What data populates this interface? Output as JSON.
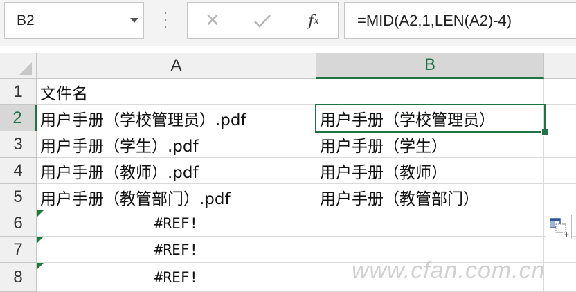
{
  "name_box": {
    "value": "B2"
  },
  "formula_bar": {
    "fx_label": "f",
    "fx_sub": "x",
    "formula": "=MID(A2,1,LEN(A2)-4)"
  },
  "columns": [
    "A",
    "B"
  ],
  "rows": [
    "1",
    "2",
    "3",
    "4",
    "5",
    "6",
    "7",
    "8"
  ],
  "cells": {
    "A1": "文件名",
    "A2": "用户手册（学校管理员）.pdf",
    "A3": "用户手册（学生）.pdf",
    "A4": "用户手册（教师）.pdf",
    "A5": "用户手册（教管部门）.pdf",
    "A6": "#REF!",
    "A7": "#REF!",
    "A8": "#REF!",
    "B2": "用户手册（学校管理员）",
    "B3": "用户手册（学生）",
    "B4": "用户手册（教师）",
    "B5": "用户手册（教管部门）"
  },
  "selection": {
    "cell": "B2",
    "accent_color": "#217346"
  },
  "watermark": "www.cfan.com.cn",
  "icons": [
    "dropdown-arrow",
    "cancel-x",
    "enter-check",
    "fx",
    "quick-analysis",
    "select-all-triangle",
    "error-indicator"
  ]
}
